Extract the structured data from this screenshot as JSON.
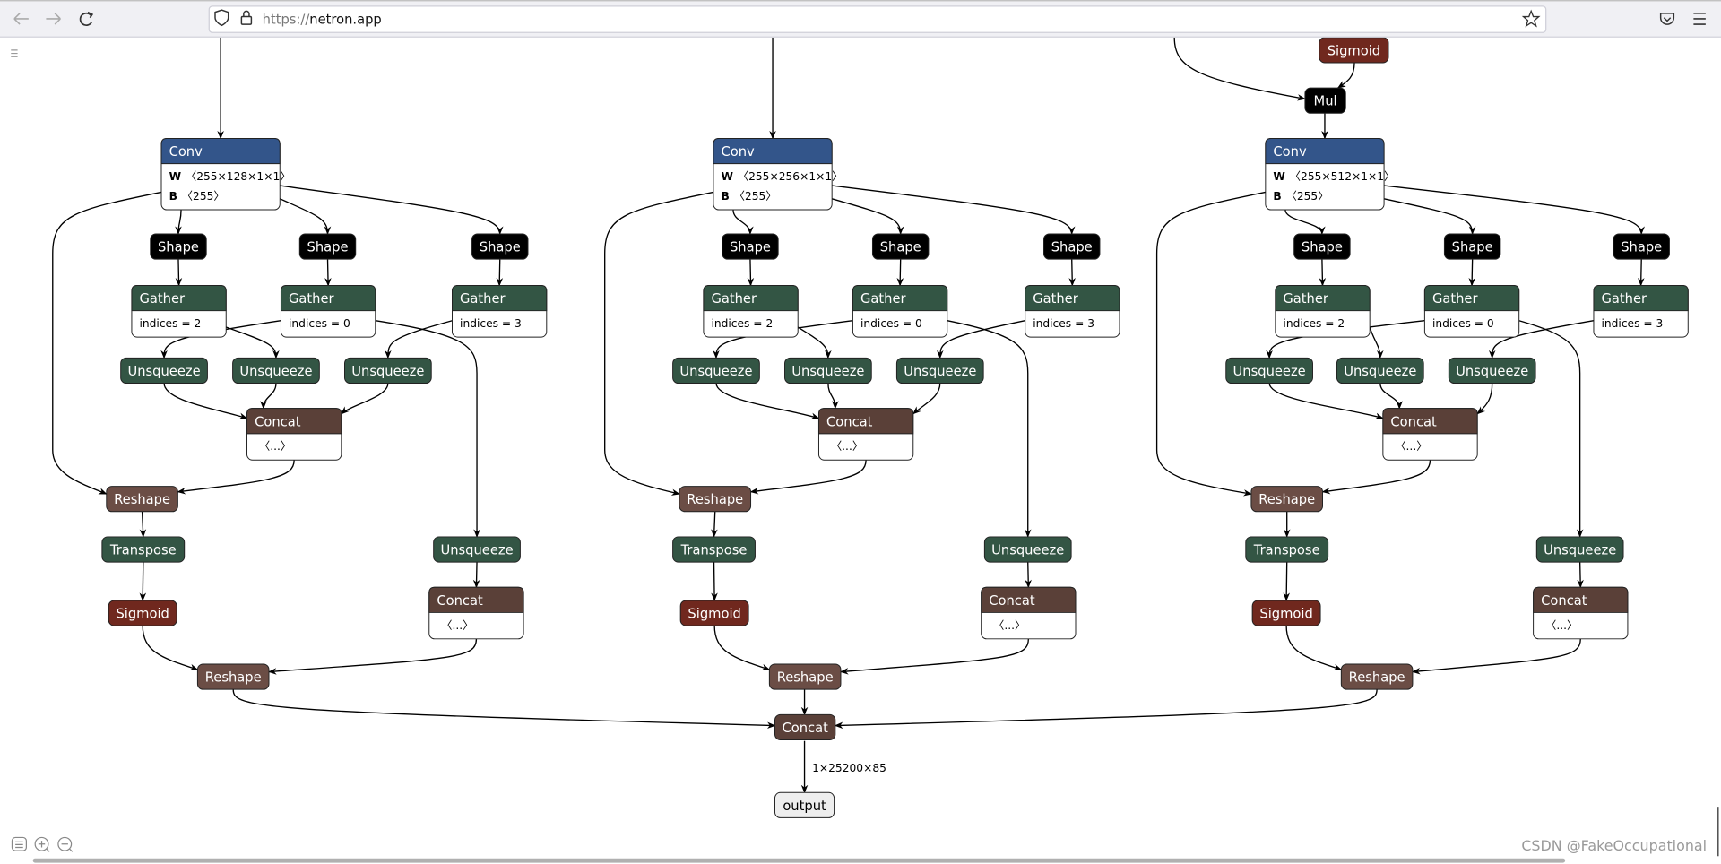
{
  "browser": {
    "url_scheme": "https://",
    "url_host": "netron.app",
    "icons": [
      "back-icon",
      "forward-icon",
      "reload-icon",
      "shield-icon",
      "lock-icon",
      "bookmark-star-icon",
      "pocket-icon",
      "menu-icon"
    ]
  },
  "app": {
    "menu_icon": "hamburger-icon",
    "bottom_icons": [
      "list-icon",
      "zoom-in-icon",
      "zoom-out-icon"
    ]
  },
  "top": {
    "sigmoid": "Sigmoid",
    "mul": "Mul"
  },
  "branches": [
    {
      "conv": {
        "op": "Conv",
        "w_key": "W",
        "w_val": "〈255×128×1×1〉",
        "b_key": "B",
        "b_val": "〈255〉"
      },
      "shape": "Shape",
      "gather": "Gather",
      "gather_attrs": [
        "indices = 2",
        "indices = 0",
        "indices = 3"
      ],
      "unsqueeze": "Unsqueeze",
      "concat": "Concat",
      "concat_attr": "〈...〉",
      "reshape": "Reshape",
      "transpose": "Transpose",
      "sigmoid": "Sigmoid"
    },
    {
      "conv": {
        "op": "Conv",
        "w_key": "W",
        "w_val": "〈255×256×1×1〉",
        "b_key": "B",
        "b_val": "〈255〉"
      },
      "shape": "Shape",
      "gather": "Gather",
      "gather_attrs": [
        "indices = 2",
        "indices = 0",
        "indices = 3"
      ],
      "unsqueeze": "Unsqueeze",
      "concat": "Concat",
      "concat_attr": "〈...〉",
      "reshape": "Reshape",
      "transpose": "Transpose",
      "sigmoid": "Sigmoid"
    },
    {
      "conv": {
        "op": "Conv",
        "w_key": "W",
        "w_val": "〈255×512×1×1〉",
        "b_key": "B",
        "b_val": "〈255〉"
      },
      "shape": "Shape",
      "gather": "Gather",
      "gather_attrs": [
        "indices = 2",
        "indices = 0",
        "indices = 3"
      ],
      "unsqueeze": "Unsqueeze",
      "concat": "Concat",
      "concat_attr": "〈...〉",
      "reshape": "Reshape",
      "transpose": "Transpose",
      "sigmoid": "Sigmoid"
    }
  ],
  "final": {
    "concat": "Concat",
    "edge_label": "1×25200×85",
    "output": "output"
  },
  "watermark": "CSDN @FakeOccupational",
  "colors": {
    "conv": "#33558a",
    "transform": "#335544",
    "tensor": "#5a4038",
    "reshape": "#6b4d45",
    "activation": "#70281e",
    "shape": "#000000",
    "output": "#eeeeee",
    "toolbar": "#f0f0f4"
  }
}
